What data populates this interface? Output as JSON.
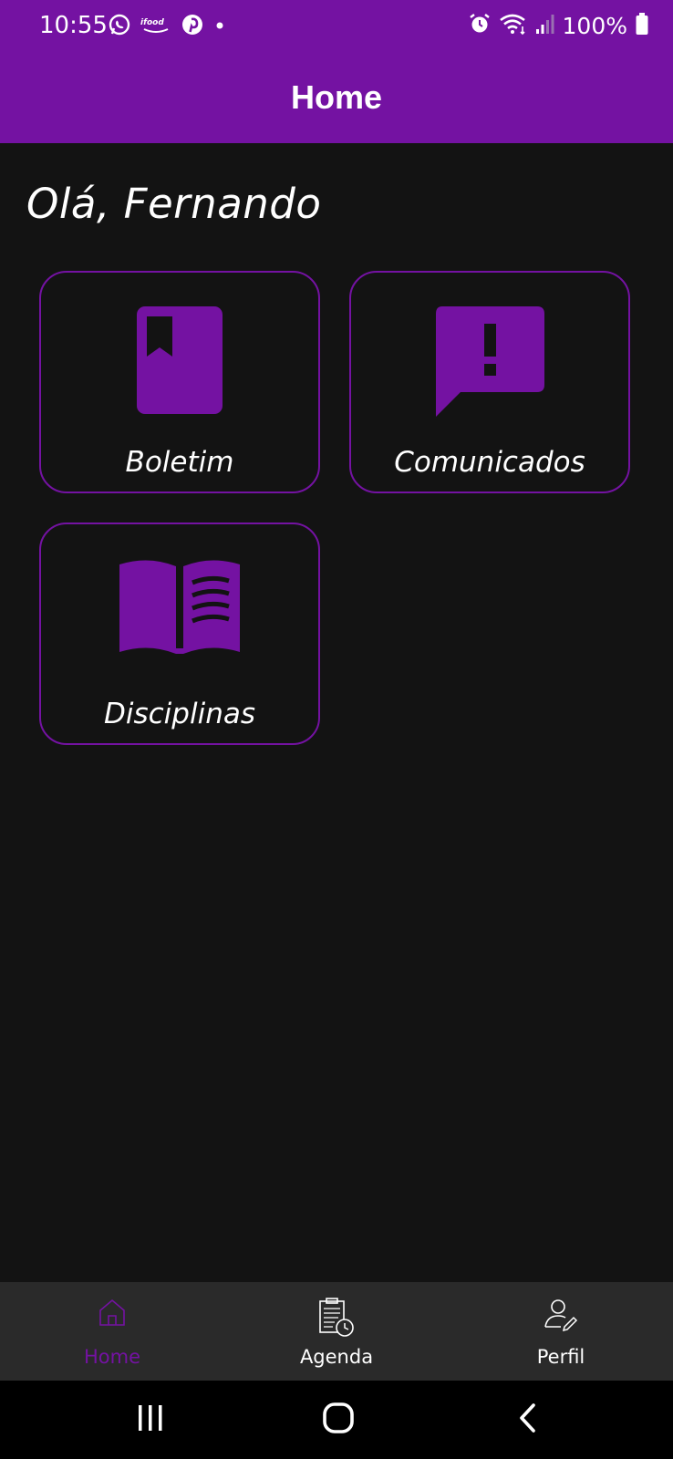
{
  "status_bar": {
    "time": "10:55",
    "battery": "100%",
    "left_icons": [
      "whatsapp-icon",
      "ifood-icon",
      "pinterest-icon",
      "dot-icon"
    ],
    "right_icons": [
      "alarm-icon",
      "wifi-icon",
      "signal-icon",
      "battery-icon"
    ]
  },
  "app_bar": {
    "title": "Home"
  },
  "greeting": "Olá, Fernando",
  "cards": [
    {
      "label": "Boletim",
      "icon": "book-bookmark-icon"
    },
    {
      "label": "Comunicados",
      "icon": "chat-alert-icon"
    },
    {
      "label": "Disciplinas",
      "icon": "open-book-icon"
    }
  ],
  "bottom_nav": {
    "items": [
      {
        "label": "Home",
        "icon": "home-icon",
        "active": true
      },
      {
        "label": "Agenda",
        "icon": "agenda-icon",
        "active": false
      },
      {
        "label": "Perfil",
        "icon": "profile-edit-icon",
        "active": false
      }
    ]
  },
  "system_nav": [
    "recents-icon",
    "home-circle-icon",
    "back-icon"
  ],
  "colors": {
    "accent": "#7412a2",
    "background": "#131313",
    "bottom_nav_bg": "#2a2a2a",
    "text": "#ffffff"
  }
}
